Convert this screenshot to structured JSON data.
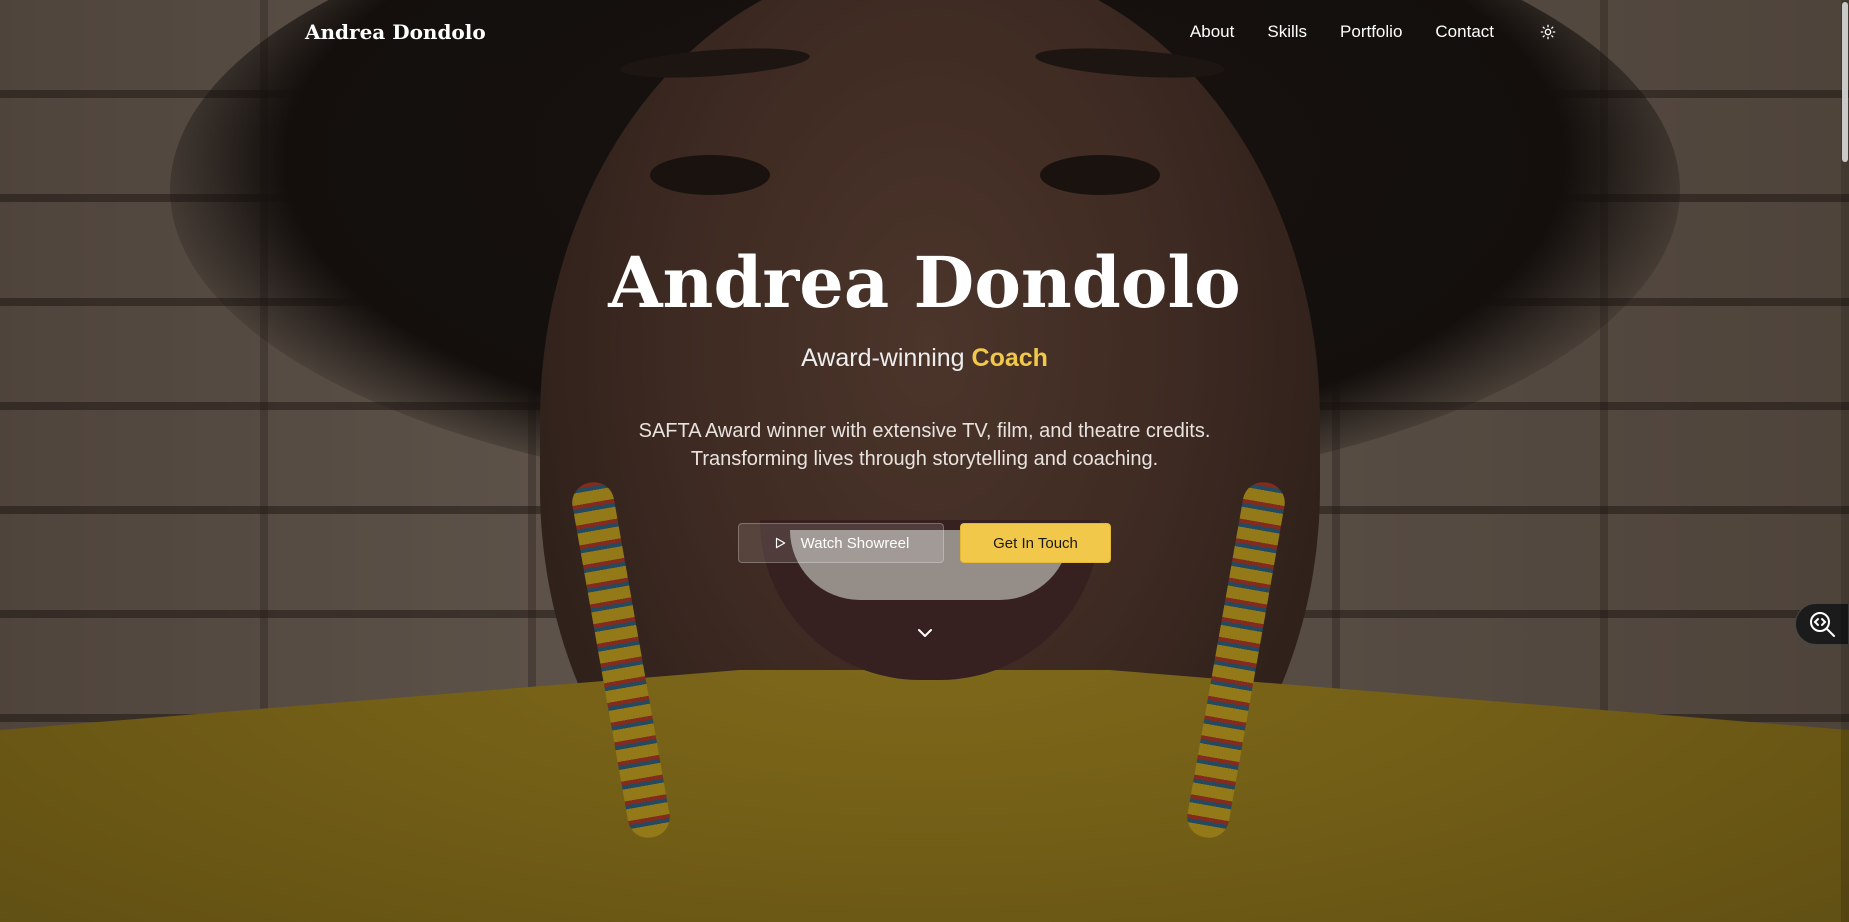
{
  "nav": {
    "brand": "Andrea Dondolo",
    "links": [
      "About",
      "Skills",
      "Portfolio",
      "Contact"
    ],
    "theme_icon": "sun-icon"
  },
  "hero": {
    "title": "Andrea Dondolo",
    "subtitle_prefix": "Award-winning ",
    "subtitle_accent": "Coach",
    "description_line1": "SAFTA Award winner with extensive TV, film, and theatre credits.",
    "description_line2": "Transforming lives through storytelling and coaching.",
    "cta_secondary": "Watch Showreel",
    "cta_primary": "Get In Touch",
    "scroll_icon": "chevron-down-icon"
  },
  "colors": {
    "accent": "#f2c84b",
    "text": "#ffffff"
  },
  "side_widget": {
    "icon": "code-search-icon"
  }
}
